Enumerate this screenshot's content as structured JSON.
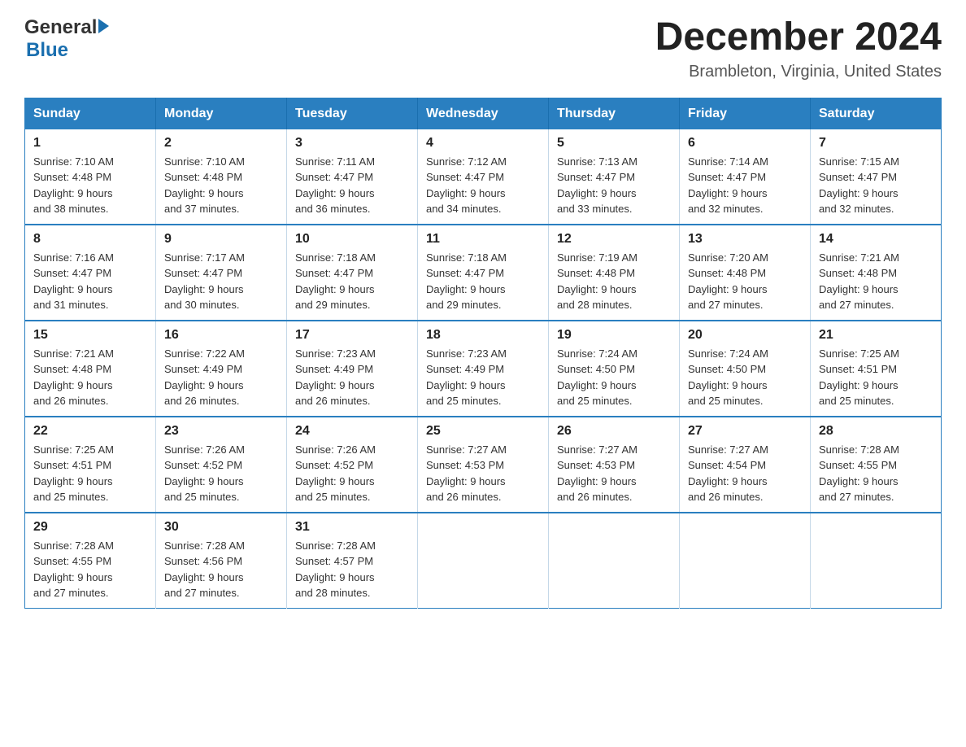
{
  "header": {
    "logo": {
      "general_text": "General",
      "blue_text": "Blue"
    },
    "title": "December 2024",
    "subtitle": "Brambleton, Virginia, United States"
  },
  "calendar": {
    "weekdays": [
      "Sunday",
      "Monday",
      "Tuesday",
      "Wednesday",
      "Thursday",
      "Friday",
      "Saturday"
    ],
    "weeks": [
      [
        {
          "day": "1",
          "sunrise": "7:10 AM",
          "sunset": "4:48 PM",
          "daylight": "9 hours and 38 minutes."
        },
        {
          "day": "2",
          "sunrise": "7:10 AM",
          "sunset": "4:48 PM",
          "daylight": "9 hours and 37 minutes."
        },
        {
          "day": "3",
          "sunrise": "7:11 AM",
          "sunset": "4:47 PM",
          "daylight": "9 hours and 36 minutes."
        },
        {
          "day": "4",
          "sunrise": "7:12 AM",
          "sunset": "4:47 PM",
          "daylight": "9 hours and 34 minutes."
        },
        {
          "day": "5",
          "sunrise": "7:13 AM",
          "sunset": "4:47 PM",
          "daylight": "9 hours and 33 minutes."
        },
        {
          "day": "6",
          "sunrise": "7:14 AM",
          "sunset": "4:47 PM",
          "daylight": "9 hours and 32 minutes."
        },
        {
          "day": "7",
          "sunrise": "7:15 AM",
          "sunset": "4:47 PM",
          "daylight": "9 hours and 32 minutes."
        }
      ],
      [
        {
          "day": "8",
          "sunrise": "7:16 AM",
          "sunset": "4:47 PM",
          "daylight": "9 hours and 31 minutes."
        },
        {
          "day": "9",
          "sunrise": "7:17 AM",
          "sunset": "4:47 PM",
          "daylight": "9 hours and 30 minutes."
        },
        {
          "day": "10",
          "sunrise": "7:18 AM",
          "sunset": "4:47 PM",
          "daylight": "9 hours and 29 minutes."
        },
        {
          "day": "11",
          "sunrise": "7:18 AM",
          "sunset": "4:47 PM",
          "daylight": "9 hours and 29 minutes."
        },
        {
          "day": "12",
          "sunrise": "7:19 AM",
          "sunset": "4:48 PM",
          "daylight": "9 hours and 28 minutes."
        },
        {
          "day": "13",
          "sunrise": "7:20 AM",
          "sunset": "4:48 PM",
          "daylight": "9 hours and 27 minutes."
        },
        {
          "day": "14",
          "sunrise": "7:21 AM",
          "sunset": "4:48 PM",
          "daylight": "9 hours and 27 minutes."
        }
      ],
      [
        {
          "day": "15",
          "sunrise": "7:21 AM",
          "sunset": "4:48 PM",
          "daylight": "9 hours and 26 minutes."
        },
        {
          "day": "16",
          "sunrise": "7:22 AM",
          "sunset": "4:49 PM",
          "daylight": "9 hours and 26 minutes."
        },
        {
          "day": "17",
          "sunrise": "7:23 AM",
          "sunset": "4:49 PM",
          "daylight": "9 hours and 26 minutes."
        },
        {
          "day": "18",
          "sunrise": "7:23 AM",
          "sunset": "4:49 PM",
          "daylight": "9 hours and 25 minutes."
        },
        {
          "day": "19",
          "sunrise": "7:24 AM",
          "sunset": "4:50 PM",
          "daylight": "9 hours and 25 minutes."
        },
        {
          "day": "20",
          "sunrise": "7:24 AM",
          "sunset": "4:50 PM",
          "daylight": "9 hours and 25 minutes."
        },
        {
          "day": "21",
          "sunrise": "7:25 AM",
          "sunset": "4:51 PM",
          "daylight": "9 hours and 25 minutes."
        }
      ],
      [
        {
          "day": "22",
          "sunrise": "7:25 AM",
          "sunset": "4:51 PM",
          "daylight": "9 hours and 25 minutes."
        },
        {
          "day": "23",
          "sunrise": "7:26 AM",
          "sunset": "4:52 PM",
          "daylight": "9 hours and 25 minutes."
        },
        {
          "day": "24",
          "sunrise": "7:26 AM",
          "sunset": "4:52 PM",
          "daylight": "9 hours and 25 minutes."
        },
        {
          "day": "25",
          "sunrise": "7:27 AM",
          "sunset": "4:53 PM",
          "daylight": "9 hours and 26 minutes."
        },
        {
          "day": "26",
          "sunrise": "7:27 AM",
          "sunset": "4:53 PM",
          "daylight": "9 hours and 26 minutes."
        },
        {
          "day": "27",
          "sunrise": "7:27 AM",
          "sunset": "4:54 PM",
          "daylight": "9 hours and 26 minutes."
        },
        {
          "day": "28",
          "sunrise": "7:28 AM",
          "sunset": "4:55 PM",
          "daylight": "9 hours and 27 minutes."
        }
      ],
      [
        {
          "day": "29",
          "sunrise": "7:28 AM",
          "sunset": "4:55 PM",
          "daylight": "9 hours and 27 minutes."
        },
        {
          "day": "30",
          "sunrise": "7:28 AM",
          "sunset": "4:56 PM",
          "daylight": "9 hours and 27 minutes."
        },
        {
          "day": "31",
          "sunrise": "7:28 AM",
          "sunset": "4:57 PM",
          "daylight": "9 hours and 28 minutes."
        },
        null,
        null,
        null,
        null
      ]
    ],
    "sunrise_label": "Sunrise: ",
    "sunset_label": "Sunset: ",
    "daylight_label": "Daylight: "
  }
}
